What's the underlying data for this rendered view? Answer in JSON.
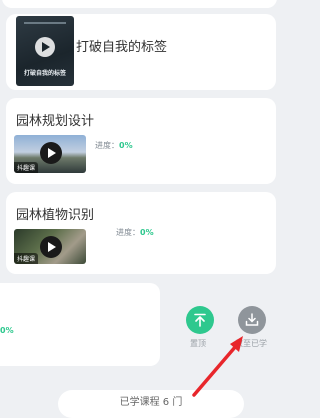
{
  "courses": [
    {
      "title": "打破自我的标签",
      "book_title": "打破自我的标签"
    },
    {
      "title": "园林规划设计",
      "tag": "抖趣课",
      "progress_label": "进度：",
      "progress_value": "0%"
    },
    {
      "title": "园林植物识别",
      "tag": "抖趣课",
      "progress_label": "进度：",
      "progress_value": "0%"
    },
    {
      "progress_value": "0%"
    }
  ],
  "actions": {
    "top_label": "置顶",
    "download_label": "放至已学"
  },
  "footer": {
    "learned_count": "已学课程 6 门"
  },
  "colors": {
    "accent": "#2ec88e",
    "annotation": "#e8262b"
  },
  "icons": [
    "play-icon",
    "pin-top-icon",
    "download-tray-icon"
  ]
}
